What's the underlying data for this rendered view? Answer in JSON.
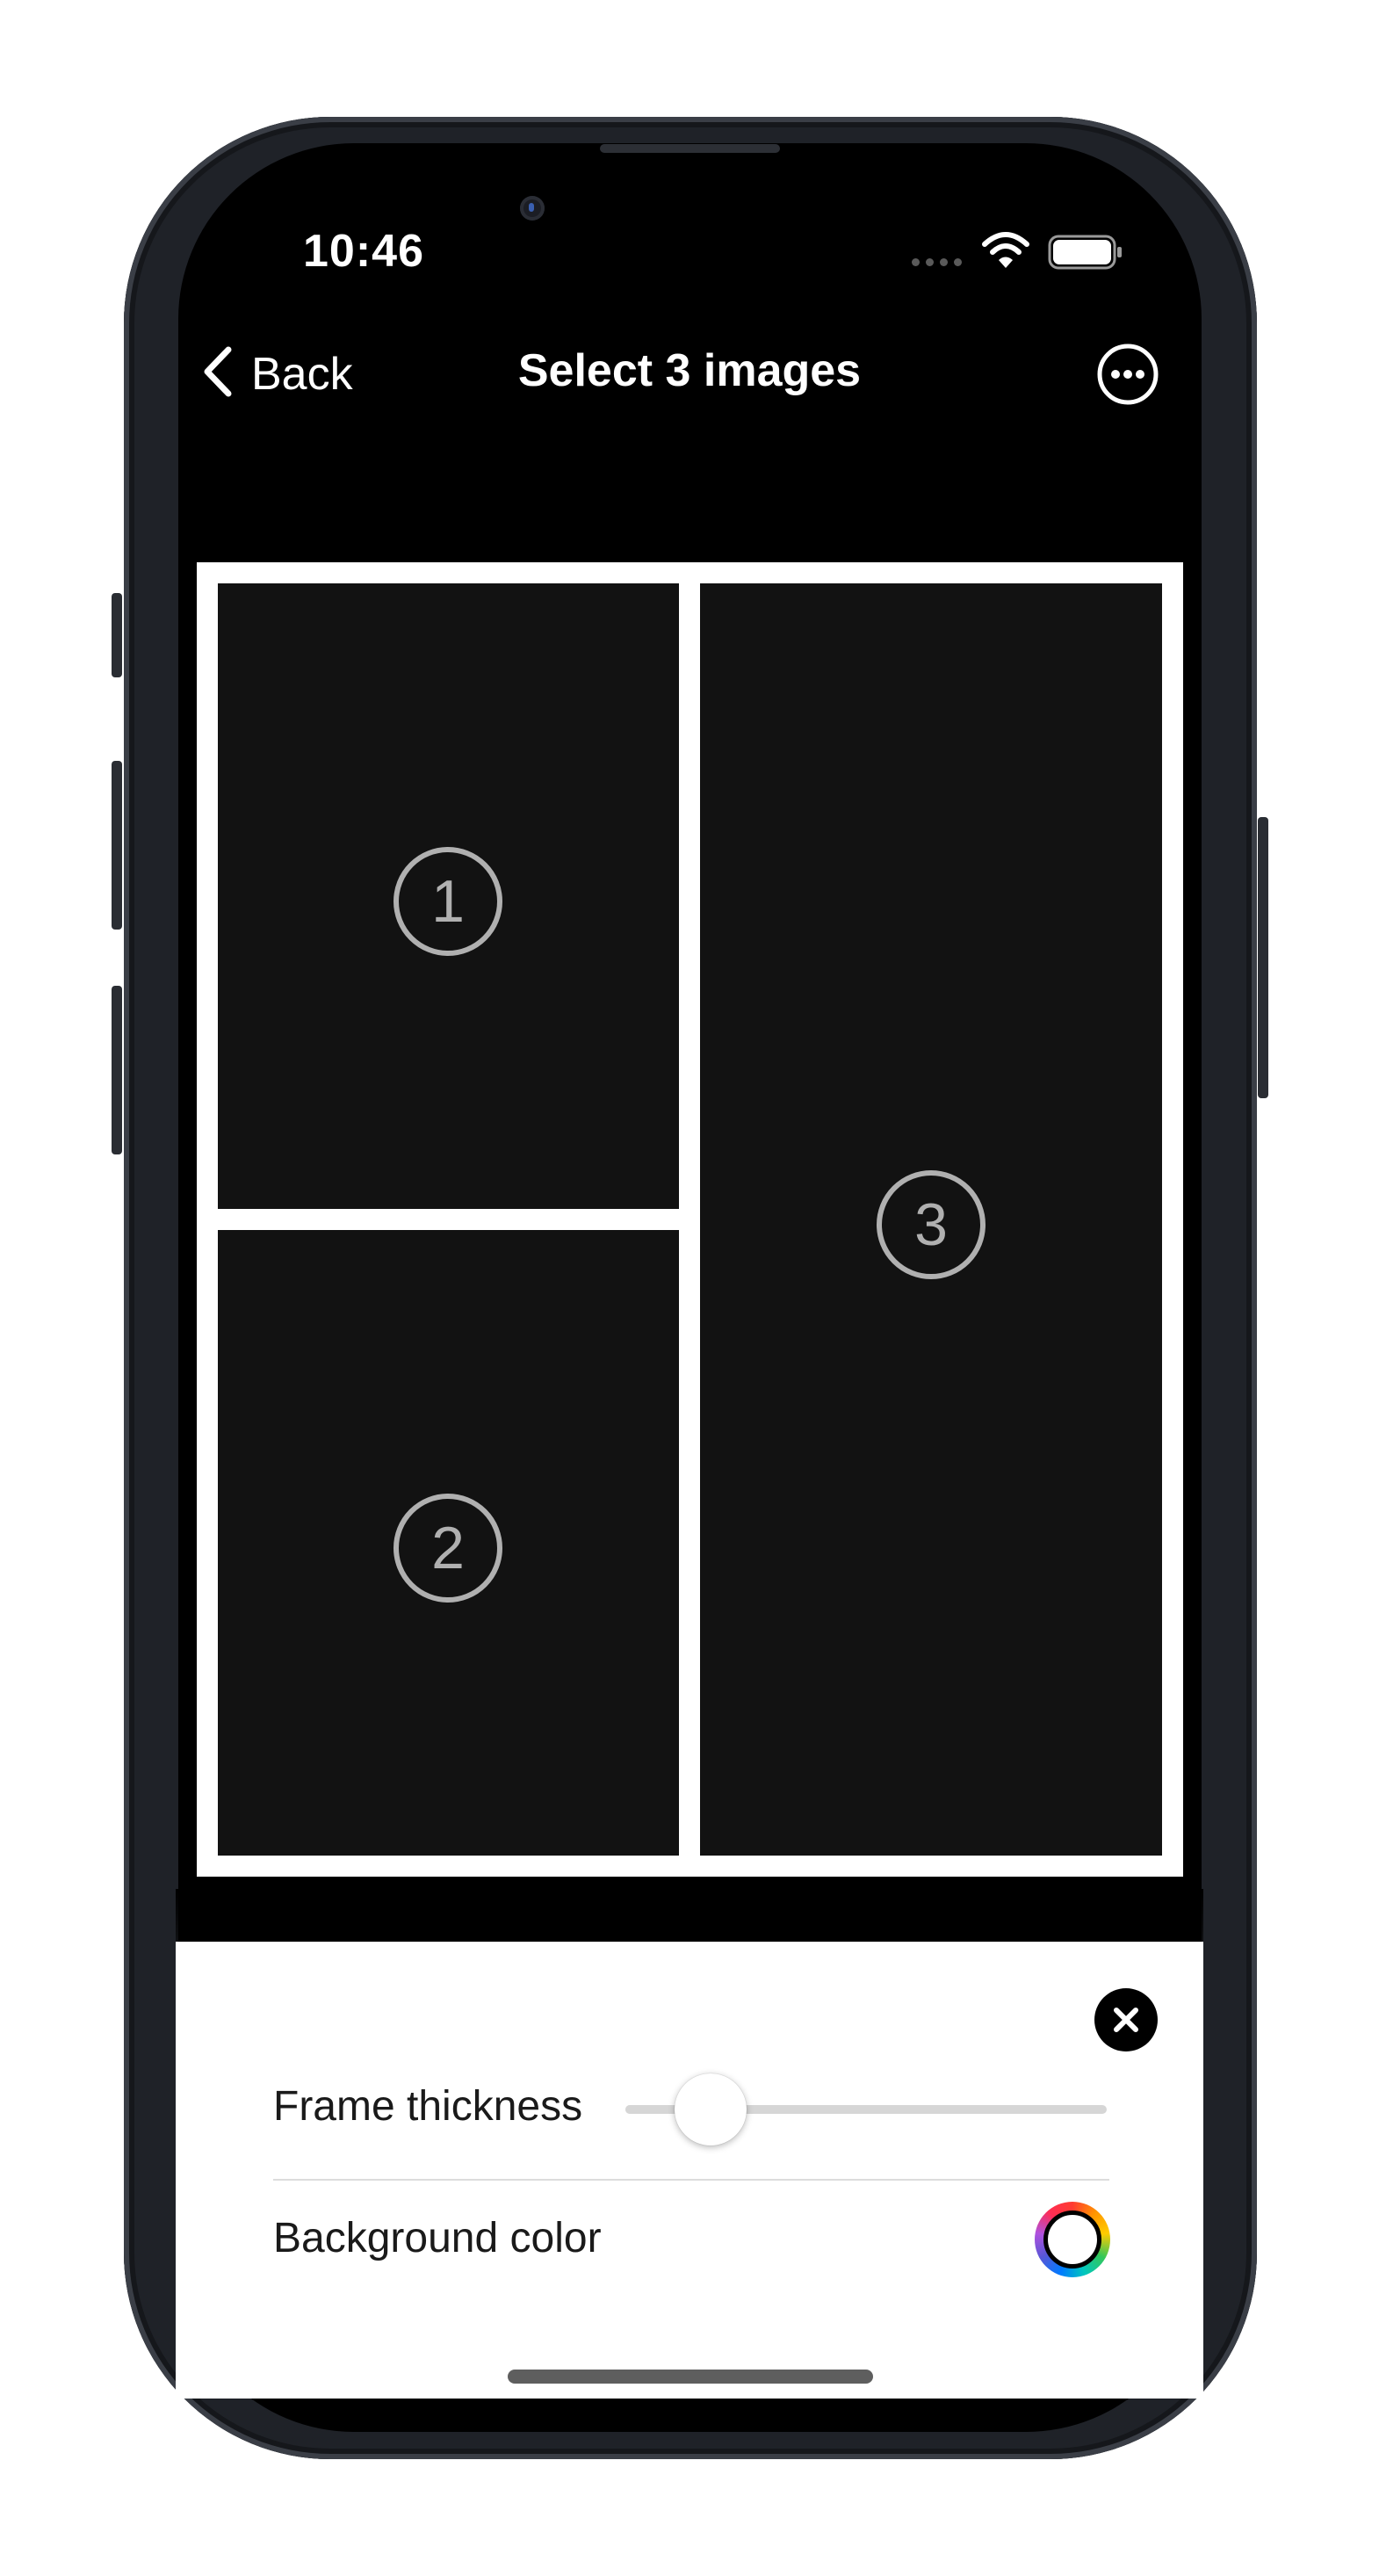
{
  "status_bar": {
    "time": "10:46"
  },
  "nav": {
    "back_label": "Back",
    "title": "Select 3 images"
  },
  "collage": {
    "frame_color": "#ffffff",
    "cells": [
      {
        "number": "1"
      },
      {
        "number": "2"
      },
      {
        "number": "3"
      }
    ]
  },
  "settings": {
    "frame_thickness_label": "Frame thickness",
    "frame_thickness_value": 0.1,
    "background_color_label": "Background color",
    "background_color": "#ffffff"
  },
  "icons": {
    "back": "chevron-left-icon",
    "more": "ellipsis-circle-icon",
    "close": "xmark-circle-icon",
    "wifi": "wifi-icon",
    "battery": "battery-icon",
    "color_picker": "color-wheel-icon"
  }
}
